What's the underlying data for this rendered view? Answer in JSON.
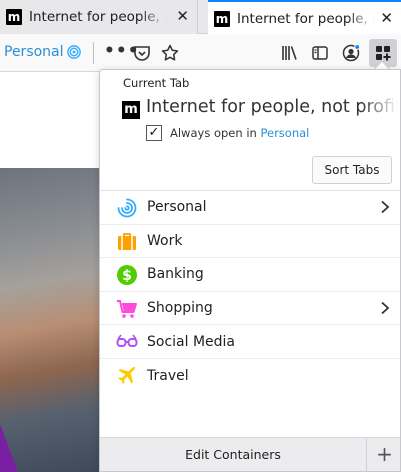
{
  "tabs": [
    {
      "favicon": "m",
      "title": "Internet for people, not profit",
      "close": "✕"
    },
    {
      "favicon": "m",
      "title": "Internet for people, not profit",
      "close": "✕"
    }
  ],
  "navbar": {
    "container_label": "Personal",
    "container_icon": "fingerprint-icon",
    "overflow": "•••",
    "icons": [
      "pocket-icon",
      "bookmark-star-icon",
      "library-icon",
      "sidebar-icon",
      "account-icon",
      "containers-extension-icon"
    ]
  },
  "panel": {
    "section_title": "Current Tab",
    "current_tab_favicon": "m",
    "current_tab_title": "Internet for people, not profit",
    "always_open_prefix": "Always open in ",
    "always_open_container": "Personal",
    "always_open_checked": true,
    "sort_button": "Sort Tabs",
    "containers": [
      {
        "name": "Personal",
        "icon": "fingerprint-icon",
        "color": "#37adff",
        "has_tabs": true
      },
      {
        "name": "Work",
        "icon": "briefcase-icon",
        "color": "#ff9f00",
        "has_tabs": false
      },
      {
        "name": "Banking",
        "icon": "dollar-icon",
        "color": "#51cd00",
        "has_tabs": false
      },
      {
        "name": "Shopping",
        "icon": "cart-icon",
        "color": "#ff4bda",
        "has_tabs": true
      },
      {
        "name": "Social Media",
        "icon": "glasses-icon",
        "color": "#af51f5",
        "has_tabs": false
      },
      {
        "name": "Travel",
        "icon": "plane-icon",
        "color": "#ffcb00",
        "has_tabs": false
      }
    ],
    "edit_button": "Edit Containers",
    "add_button": "+"
  },
  "colors": {
    "accent": "#0a84ff",
    "link": "#2b8fd6"
  }
}
